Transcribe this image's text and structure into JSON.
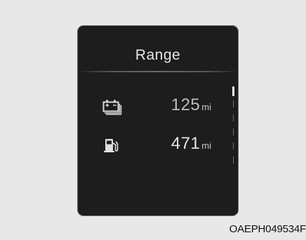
{
  "screen": {
    "title": "Range",
    "rows": [
      {
        "icon": "battery-icon",
        "value": "125",
        "unit": "mi"
      },
      {
        "icon": "fuel-pump-icon",
        "value": "471",
        "unit": "mi"
      }
    ]
  },
  "caption": "OAEPH049534F"
}
